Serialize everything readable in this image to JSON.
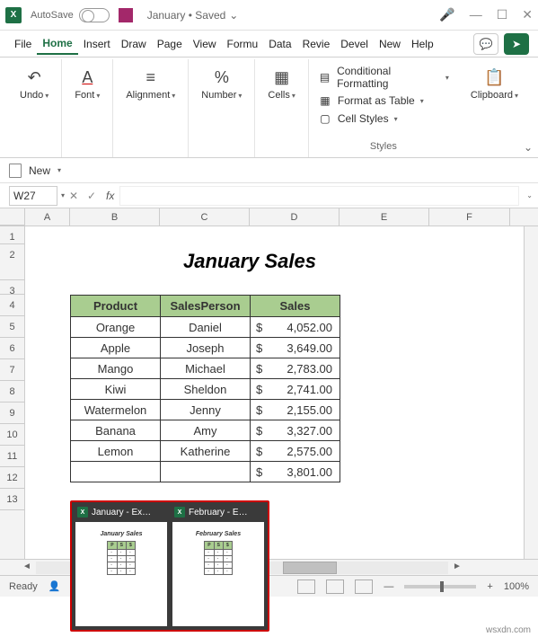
{
  "titlebar": {
    "autosave": "AutoSave",
    "doc": "January • Saved"
  },
  "menu": {
    "file": "File",
    "home": "Home",
    "insert": "Insert",
    "draw": "Draw",
    "page": "Page",
    "view": "View",
    "formu": "Formu",
    "data": "Data",
    "review": "Revie",
    "devel": "Devel",
    "new": "New",
    "help": "Help"
  },
  "ribbon": {
    "undo": "Undo",
    "font": "Font",
    "alignment": "Alignment",
    "number": "Number",
    "cells": "Cells",
    "cond_fmt": "Conditional Formatting",
    "fmt_table": "Format as Table",
    "cell_styles": "Cell Styles",
    "styles_caption": "Styles",
    "clipboard": "Clipboard"
  },
  "newbar": {
    "new": "New"
  },
  "namebox": "W27",
  "sheet": {
    "title": "January Sales",
    "headers": {
      "product": "Product",
      "salesperson": "SalesPerson",
      "sales": "Sales"
    },
    "rows": [
      {
        "product": "Orange",
        "person": "Daniel",
        "sales": "4,052.00"
      },
      {
        "product": "Apple",
        "person": "Joseph",
        "sales": "3,649.00"
      },
      {
        "product": "Mango",
        "person": "Michael",
        "sales": "2,783.00"
      },
      {
        "product": "Kiwi",
        "person": "Sheldon",
        "sales": "2,741.00"
      },
      {
        "product": "Watermelon",
        "person": "Jenny",
        "sales": "2,155.00"
      },
      {
        "product": "Banana",
        "person": "Amy",
        "sales": "3,327.00"
      },
      {
        "product": "Lemon",
        "person": "Katherine",
        "sales": "2,575.00"
      },
      {
        "product": "",
        "person": "",
        "sales": "3,801.00"
      }
    ]
  },
  "cols": [
    "A",
    "B",
    "C",
    "D",
    "E",
    "F"
  ],
  "rownums": [
    "1",
    "2",
    "3",
    "4",
    "5",
    "6",
    "7",
    "8",
    "9",
    "10",
    "11",
    "12",
    "13"
  ],
  "taskbar": {
    "jan": "January - Ex…",
    "feb": "February - E…",
    "thumb_feb": "February Sales"
  },
  "status": {
    "ready": "Ready",
    "zoom": "100%"
  },
  "watermark": "wsxdn.com"
}
